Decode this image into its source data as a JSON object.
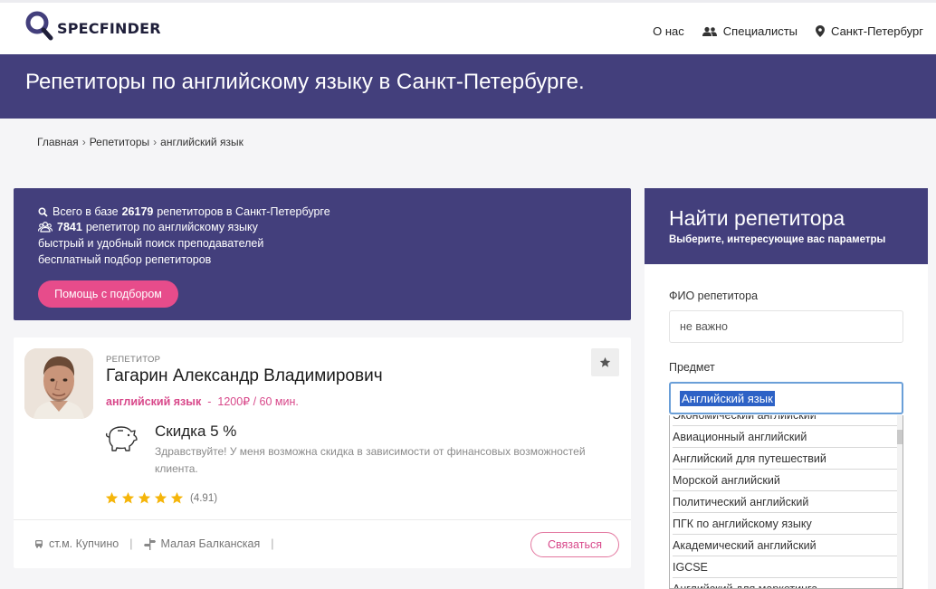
{
  "brand": {
    "name": "SPECFINDER"
  },
  "nav": {
    "about": "О нас",
    "specialists": "Специалисты",
    "city": "Санкт-Петербург"
  },
  "hero": {
    "title": "Репетиторы по английскому языку в Санкт-Петербурге."
  },
  "breadcrumbs": [
    "Главная",
    "Репетиторы",
    "английский язык"
  ],
  "info": {
    "line1_prefix": "Всего в базе",
    "line1_count": "26179",
    "line1_suffix": "репетиторов в Санкт-Петербурге",
    "line2_count": "7841",
    "line2_suffix": "репетитор по английскому языку",
    "line3": "быстрый и удобный поиск преподавателей",
    "line4": "бесплатный подбор репетиторов",
    "help_button": "Помощь с подбором"
  },
  "tutor": {
    "role": "РЕПЕТИТОР",
    "name": "Гагарин Александр Владимирович",
    "subject": "английский язык",
    "dash": "-",
    "price": "1200₽ / 60 мин.",
    "discount_title": "Скидка 5 %",
    "discount_text": "Здравствуйте! У меня возможна скидка в зависимости от финансовых возможностей клиента.",
    "stars": 5,
    "rating": "(4.91)",
    "metro": "ст.м. Купчино",
    "street": "Малая Балканская",
    "contact_button": "Связаться"
  },
  "sidebar": {
    "title": "Найти репетитора",
    "subtitle": "Выберите, интересующие вас параметры",
    "fio_label": "ФИО репетитора",
    "fio_value": "не важно",
    "subject_label": "Предмет",
    "subject_selected": "Английский язык",
    "options": [
      "Экономический английский",
      "Авиационный английский",
      "Английский для путешествий",
      "Морской английский",
      "Политический английский",
      "ПГК по английскому языку",
      "Академический английский",
      "IGCSE",
      "Английский для маркетинга"
    ]
  },
  "colors": {
    "primary": "#433f7c",
    "accent": "#e74c8b",
    "star": "#f5b50a"
  }
}
